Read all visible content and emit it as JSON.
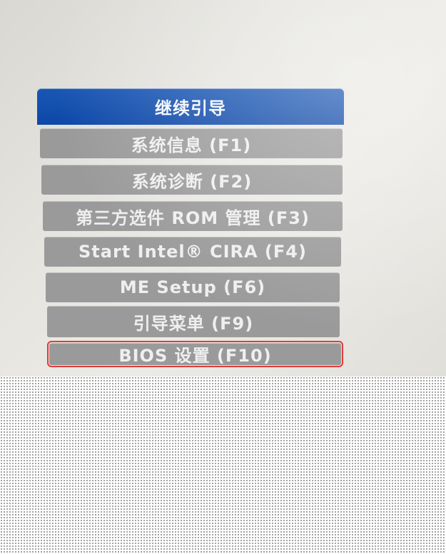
{
  "menu": {
    "items": [
      {
        "label": "继续引导",
        "state": "selected"
      },
      {
        "label": "系统信息 (F1)",
        "state": "normal"
      },
      {
        "label": "系统诊断 (F2)",
        "state": "normal"
      },
      {
        "label": "第三方选件 ROM 管理 (F3)",
        "state": "normal"
      },
      {
        "label": "Start Intel® CIRA (F4)",
        "state": "normal"
      },
      {
        "label": "ME Setup (F6)",
        "state": "normal"
      },
      {
        "label": "引导菜单 (F9)",
        "state": "normal"
      },
      {
        "label": "BIOS 设置 (F10)",
        "state": "annotated"
      }
    ]
  },
  "colors": {
    "selected_bg": "#0d48a8",
    "item_bg": "#9a9a9a",
    "item_text": "#efefef",
    "annotation_outline": "#e23a3a"
  }
}
